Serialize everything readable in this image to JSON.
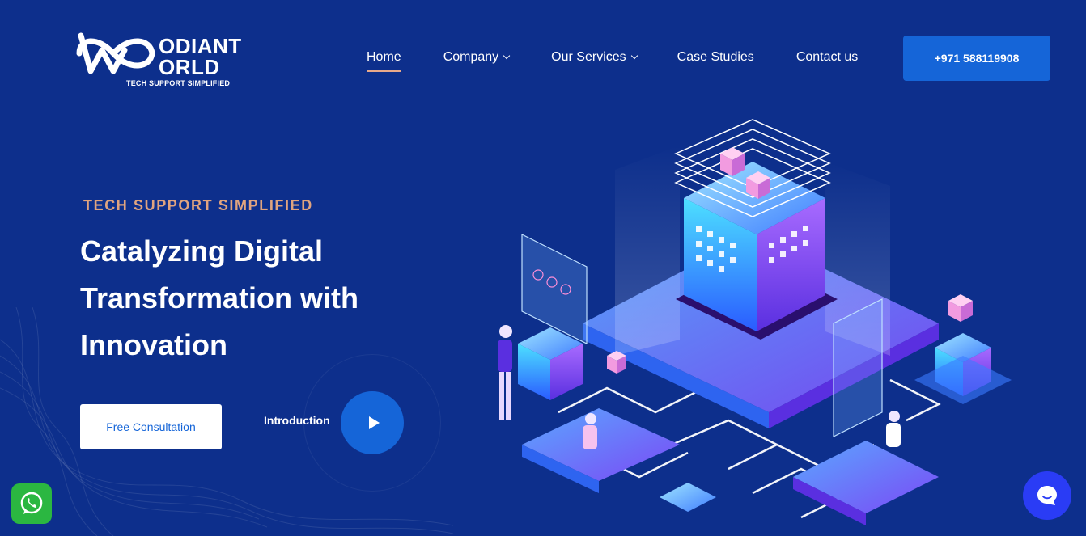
{
  "brand": {
    "logo_line1": "ODIANT",
    "logo_line2": "ORLD",
    "tagline": "TECH SUPPORT SIMPLIFIED"
  },
  "nav": {
    "items": [
      {
        "label": "Home",
        "active": true,
        "dropdown": false
      },
      {
        "label": "Company",
        "active": false,
        "dropdown": true
      },
      {
        "label": "Our Services",
        "active": false,
        "dropdown": true
      },
      {
        "label": "Case Studies",
        "active": false,
        "dropdown": false
      },
      {
        "label": "Contact us",
        "active": false,
        "dropdown": false
      }
    ],
    "phone": "+971 588119908"
  },
  "hero": {
    "eyebrow": "TECH SUPPORT SIMPLIFIED",
    "headline_line1": "Catalyzing Digital",
    "headline_line2": "Transformation with",
    "headline_line3": "Innovation",
    "cta_label": "Free Consultation",
    "intro_label": "Introduction"
  },
  "widgets": {
    "whatsapp_icon": "whatsapp-icon",
    "chat_icon": "chat-bubble-icon"
  },
  "colors": {
    "background": "#0d2f8c",
    "accent_blue": "#1565d8",
    "eyebrow": "#e0a47f",
    "whatsapp_green": "#2bb741",
    "chat_purple": "#2a3cf5"
  }
}
